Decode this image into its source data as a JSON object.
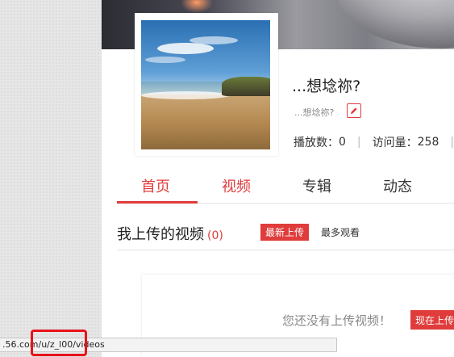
{
  "profile": {
    "username": "...想埝祢?",
    "signature": "...想埝祢?",
    "stats": [
      {
        "label": "播放数",
        "value": "0"
      },
      {
        "label": "访问量",
        "value": "258"
      }
    ]
  },
  "tabs": [
    {
      "label": "首页",
      "active": true
    },
    {
      "label": "视频",
      "active": false
    },
    {
      "label": "专辑",
      "active": false
    },
    {
      "label": "动态",
      "active": false
    }
  ],
  "section": {
    "title": "我上传的视频",
    "count": "(0)",
    "sort_latest": "最新上传",
    "sort_most": "最多观看"
  },
  "empty": {
    "message": "您还没有上传视频！",
    "upload_button": "现在上传"
  },
  "status_bar": {
    "url": ".56.com/u/z_l00/videos"
  },
  "colors": {
    "accent": "#e03c3c",
    "highlight_box": "#e8131a"
  },
  "icons": {
    "edit": "pencil-icon"
  }
}
